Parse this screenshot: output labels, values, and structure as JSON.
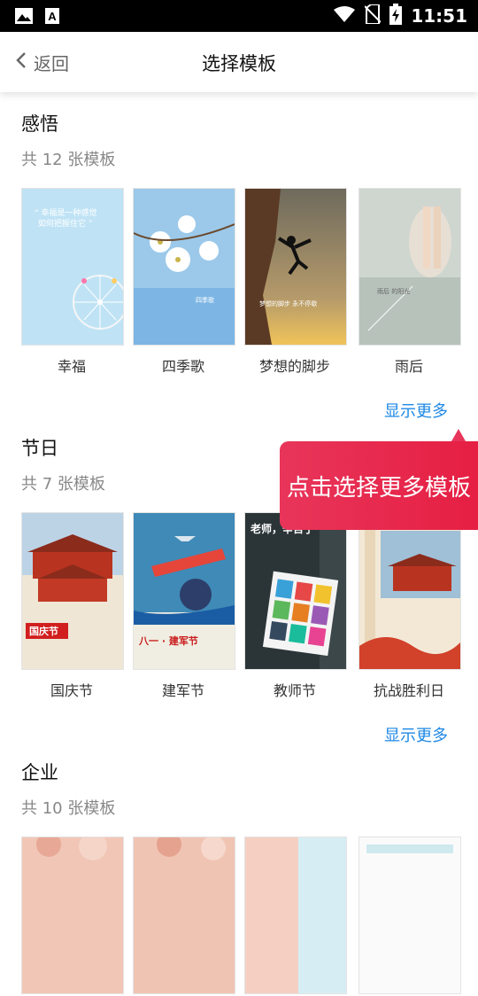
{
  "status_bar": {
    "time": "11:51",
    "icons": [
      "image-icon",
      "a-icon",
      "wifi-icon",
      "no-sim-icon",
      "battery-charging-icon"
    ]
  },
  "header": {
    "back_label": "返回",
    "title": "选择模板"
  },
  "sections": [
    {
      "title": "感悟",
      "count": "共 12 张模板",
      "more": "显示更多",
      "items": [
        {
          "label": "幸福",
          "theme": "sky-ferris-wheel"
        },
        {
          "label": "四季歌",
          "theme": "white-flowers"
        },
        {
          "label": "梦想的脚步",
          "theme": "rock-climber"
        },
        {
          "label": "雨后",
          "theme": "rain-legs"
        }
      ]
    },
    {
      "title": "节日",
      "count": "共 7 张模板",
      "more": "显示更多",
      "items": [
        {
          "label": "国庆节",
          "theme": "tiananmen",
          "poster_text": "国庆节"
        },
        {
          "label": "建军节",
          "theme": "military",
          "poster_text": "八一 · 建军节"
        },
        {
          "label": "教师节",
          "theme": "teacher",
          "poster_text": "老师，辛苦了"
        },
        {
          "label": "抗战胜利日",
          "theme": "victory-day"
        }
      ]
    },
    {
      "title": "企业",
      "count": "共 10 张模板",
      "items": [
        {
          "label": "",
          "theme": "corp-1"
        },
        {
          "label": "",
          "theme": "corp-2"
        },
        {
          "label": "",
          "theme": "corp-3"
        },
        {
          "label": "",
          "theme": "corp-4"
        }
      ]
    }
  ],
  "tooltip": {
    "text": "点击选择更多模板"
  },
  "colors": {
    "link": "#1e88e5",
    "tooltip": "#e8355a"
  }
}
